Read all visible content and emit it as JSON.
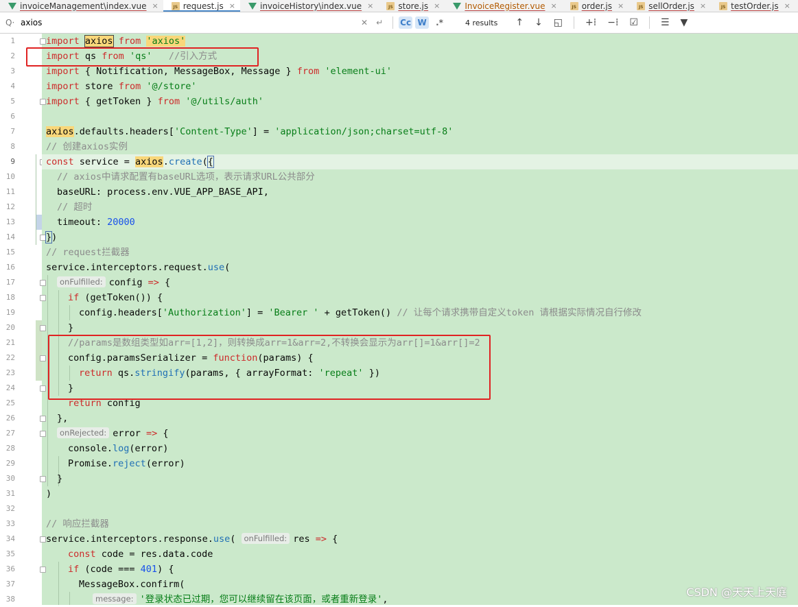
{
  "tabs": [
    {
      "label": "invoiceManagement\\index.vue",
      "type": "vue",
      "active": false
    },
    {
      "label": "request.js",
      "type": "js",
      "active": true
    },
    {
      "label": "invoiceHistory\\index.vue",
      "type": "vue",
      "active": false
    },
    {
      "label": "store.js",
      "type": "js",
      "active": false
    },
    {
      "label": "InvoiceRegister.vue",
      "type": "vue",
      "active": false
    },
    {
      "label": "order.js",
      "type": "js",
      "active": false
    },
    {
      "label": "sellOrder.js",
      "type": "js",
      "active": false
    },
    {
      "label": "testOrder.js",
      "type": "js",
      "active": false
    }
  ],
  "find": {
    "query": "axios",
    "results": "4 results",
    "case_toggle": "Cc",
    "word_toggle": "W",
    "regex_toggle": ".*"
  },
  "code": {
    "line_numbers": [
      "1",
      "2",
      "3",
      "4",
      "5",
      "6",
      "7",
      "8",
      "9",
      "10",
      "11",
      "12",
      "13",
      "14",
      "15",
      "16",
      "17",
      "18",
      "19",
      "20",
      "21",
      "22",
      "23",
      "24",
      "25",
      "26",
      "27",
      "28",
      "29",
      "30",
      "31",
      "32",
      "33",
      "34",
      "35",
      "36",
      "37",
      "38"
    ],
    "hints": {
      "on_fulfilled": "onFulfilled:",
      "on_rejected": "onRejected:",
      "message": "message:"
    }
  },
  "watermark": "CSDN @天天上天庭"
}
